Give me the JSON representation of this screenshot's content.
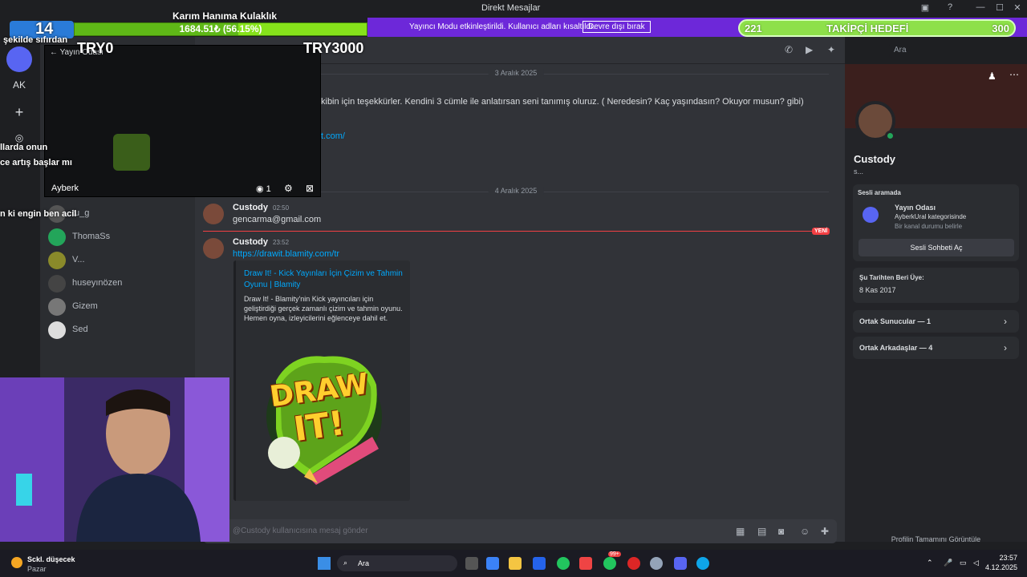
{
  "window": {
    "title": "Direkt Mesajlar"
  },
  "stream_overlay": {
    "title": "Karım Hanıma Kulaklık",
    "progress_text": "1684.51₺ (56.15%)",
    "progress": 0.5615,
    "min_label": "TRY0",
    "max_label": "TRY3000",
    "vip_message": "Yayıncı Modu etkinleştirildi. Kullanıcı adları kısaltıldı.",
    "vip_button": "Devre dışı bırak",
    "follower_goal": {
      "current": "221",
      "label": "TAKİPÇİ HEDEFİ",
      "target": "300"
    },
    "left_texts": [
      "şekilde sıfırdan",
      "llarda onun",
      "ce artış başlar mı",
      "n ki engin ben acil"
    ],
    "counter": "14"
  },
  "rail": {
    "items": [
      "AK",
      "+"
    ]
  },
  "preview": {
    "back_label": "Yayın Odası",
    "streamer": "Ayberk",
    "viewers": "1"
  },
  "dm_list": [
    {
      "name": "tu_g"
    },
    {
      "name": "ThomaSs"
    },
    {
      "name": "V..."
    },
    {
      "name": "huseyınözen"
    },
    {
      "name": "Gizem"
    },
    {
      "name": "Sed"
    }
  ],
  "chat": {
    "search_placeholder": "Ara",
    "date1": "3 Aralık 2025",
    "partial_text": "kibin için teşekkürler. Kendini 3 cümle ile anlatırsan seni tanımış oluruz. ( Neredesin? Kaç yaşındasın? Okuyor musun? gibi)",
    "partial_link": "t.com/",
    "date2": "4 Aralık 2025",
    "messages": [
      {
        "author": "Custody",
        "time": "02:50",
        "text": "gencarma@gmail.com"
      },
      {
        "author": "Custody",
        "time": "23:52",
        "text": "https://drawit.blamity.com/tr"
      }
    ],
    "new_tag": "YENİ",
    "embed": {
      "title": "Draw It! - Kick Yayınları İçin Çizim ve Tahmin Oyunu | Blamity",
      "description": "Draw It! - Blamity'nin Kick yayıncıları için geliştirdiği gerçek zamanlı çizim ve tahmin oyunu. Hemen oyna, izleyicilerini eğlenceye dahil et.",
      "logo_text_1": "DRAW",
      "logo_text_2": "IT!"
    },
    "input_placeholder": "@Custody kullanıcısına mesaj gönder"
  },
  "profile": {
    "name": "Custody",
    "tag": "s...",
    "voice_section": "Sesli aramada",
    "voice_channel": "Yayın Odası",
    "voice_category": "AyberkUral kategorisinde",
    "voice_status": "Bir kanal durumu belirle",
    "voice_button": "Sesli Sohbeti Aç",
    "member_since_label": "Şu Tarihten Beri Üye:",
    "member_since": "8 Kas 2017",
    "mutual_servers": "Ortak Sunucular — 1",
    "mutual_friends": "Ortak Arkadaşlar — 4",
    "view_full": "Profilin Tamamını Görüntüle"
  },
  "taskbar": {
    "weather": "Sckl. düşecek",
    "weather_sub": "Pazar",
    "search": "Ara",
    "time": "23:57",
    "date": "4.12.2025",
    "badge": "99+"
  },
  "colors": {
    "accent": "#5865f2",
    "online": "#23a55a",
    "new": "#f23f43",
    "link": "#00a8fc",
    "stream_purple": "#6d28d9",
    "goal_green": "#8ee04a"
  }
}
